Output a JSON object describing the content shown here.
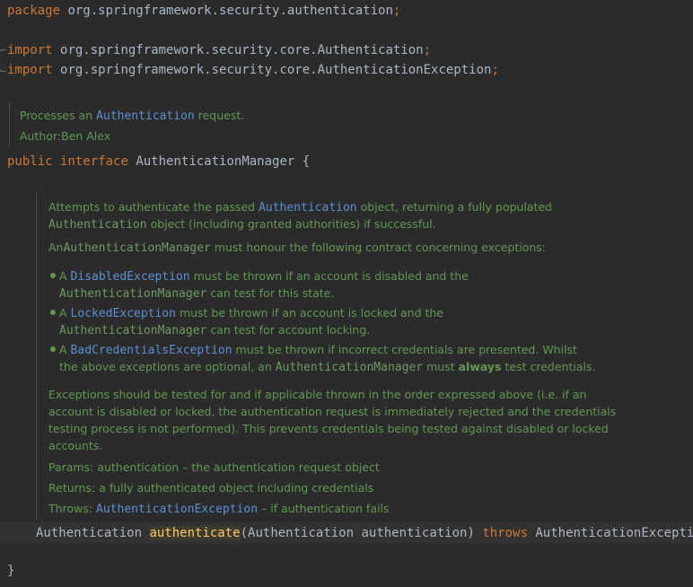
{
  "editor": {
    "package_line": {
      "keyword": "package",
      "name": "org.springframework.security.authentication",
      "semicolon": ";"
    },
    "imports": [
      {
        "keyword": "import",
        "name": "org.springframework.security.core.Authentication",
        "semicolon": ";"
      },
      {
        "keyword": "import",
        "name": "org.springframework.security.core.AuthenticationException",
        "semicolon": ";"
      }
    ],
    "class_doc": {
      "line1_prefix": "Processes an",
      "line1_ref": "Authentication",
      "line1_suffix": "request.",
      "author_label": "Author:",
      "author_name": "Ben Alex"
    },
    "interface_decl": {
      "kw1": "public",
      "kw2": "interface",
      "name": "AuthenticationManager",
      "brace": "{"
    },
    "method_doc": {
      "p1_a": "Attempts to authenticate the passed",
      "p1_ref": "Authentication",
      "p1_b": "object, returning a fully populated",
      "p1_code": "Authentication",
      "p1_c": "object (including granted authorities) if successful.",
      "p2_a": "An",
      "p2_code": "AuthenticationManager",
      "p2_b": "must honour the following contract concerning exceptions:",
      "bullets": [
        {
          "a": "A",
          "ref": "DisabledException",
          "b": "must be thrown if an account is disabled and the",
          "code": "AuthenticationManager",
          "c": "can test for this state."
        },
        {
          "a": "A",
          "ref": "LockedException",
          "b": "must be thrown if an account is locked and the",
          "code": "AuthenticationManager",
          "c": "can test for account locking."
        },
        {
          "a": "A",
          "ref": "BadCredentialsException",
          "b": "must be thrown if incorrect credentials are presented. Whilst",
          "c1": "the above exceptions are optional, an",
          "code": "AuthenticationManager",
          "c2": "must",
          "bold": "always",
          "c3": "test credentials."
        }
      ],
      "p3_lines": [
        "Exceptions should be tested for and if applicable thrown in the order expressed above (i.e. if an",
        "account is disabled or locked, the authentication request is immediately rejected and the credentials",
        "testing process is not performed). This prevents credentials being tested against disabled or locked",
        "accounts."
      ],
      "params_label": "Params:",
      "params_text": "authentication – the authentication request object",
      "returns_label": "Returns:",
      "returns_text": "a fully authenticated object including credentials",
      "throws_label": "Throws:",
      "throws_ref": "AuthenticationException",
      "throws_text": "– if authentication fails"
    },
    "method_decl": {
      "return_type": "Authentication",
      "name": "authenticate",
      "params": "(Authentication authentication)",
      "throws_kw": "throws",
      "exception": "AuthenticationException",
      "semicolon": ";"
    },
    "closing_brace": "}"
  },
  "colors": {
    "background": "#2b2b2b",
    "keyword": "#cc7832",
    "text": "#a9b7c6",
    "doc_text": "#629755",
    "doc_link": "#5c8fd2",
    "method_name": "#ffc66d"
  }
}
